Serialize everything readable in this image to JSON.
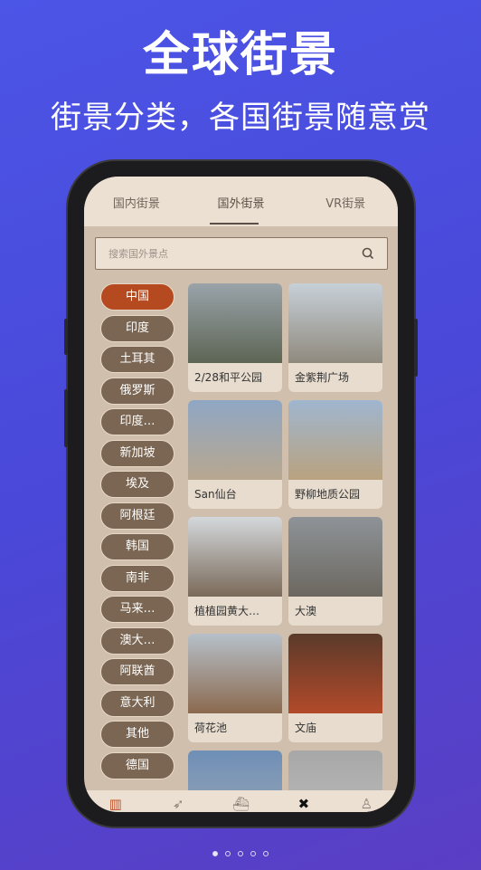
{
  "promo": {
    "title": "全球街景",
    "subtitle": "街景分类，各国街景随意赏"
  },
  "tabs": [
    {
      "label": "国内街景"
    },
    {
      "label": "国外街景",
      "active": true
    },
    {
      "label": "VR街景"
    }
  ],
  "search": {
    "placeholder": "搜索国外景点",
    "icon": "search-icon"
  },
  "countries": [
    "中国",
    "印度",
    "土耳其",
    "俄罗斯",
    "印度…",
    "新加坡",
    "埃及",
    "阿根廷",
    "韩国",
    "南非",
    "马来…",
    "澳大…",
    "阿联酋",
    "意大利",
    "其他",
    "德国"
  ],
  "selected_country": "中国",
  "places": [
    {
      "name": "2/28和平公园",
      "colors": [
        "#9aa3a9",
        "#5d6555"
      ]
    },
    {
      "name": "金紫荆广场",
      "colors": [
        "#c7d0d8",
        "#8f8a7e"
      ]
    },
    {
      "name": "San仙台",
      "colors": [
        "#8fa7c4",
        "#b8a78f"
      ]
    },
    {
      "name": "野柳地质公园",
      "colors": [
        "#9fb6cf",
        "#b9a27f"
      ]
    },
    {
      "name": "植植园黄大…",
      "colors": [
        "#d4d8dc",
        "#7a6a5a"
      ]
    },
    {
      "name": "大澳",
      "colors": [
        "#8e9398",
        "#6c6860"
      ]
    },
    {
      "name": "荷花池",
      "colors": [
        "#b6c0c9",
        "#8b6a4f"
      ]
    },
    {
      "name": "文庙",
      "colors": [
        "#5a3a2a",
        "#b24a2a"
      ]
    },
    {
      "name": "",
      "colors": [
        "#6f8fb6",
        "#9aa7b6"
      ]
    },
    {
      "name": "",
      "colors": [
        "#a7a7a7",
        "#bdbdbd"
      ]
    }
  ],
  "nav": [
    {
      "label": "街景",
      "icon": "building-icon",
      "active": true
    },
    {
      "label": "指南针",
      "icon": "compass-icon"
    },
    {
      "label": "家乡",
      "icon": "hometown-icon"
    },
    {
      "label": "工具",
      "icon": "tools-icon"
    },
    {
      "label": "账户",
      "icon": "user-icon"
    }
  ],
  "pager": {
    "count": 5,
    "current": 1
  },
  "colors": {
    "accent": "#b5491f",
    "pill": "#7a6652",
    "background": "#4a48d8"
  }
}
